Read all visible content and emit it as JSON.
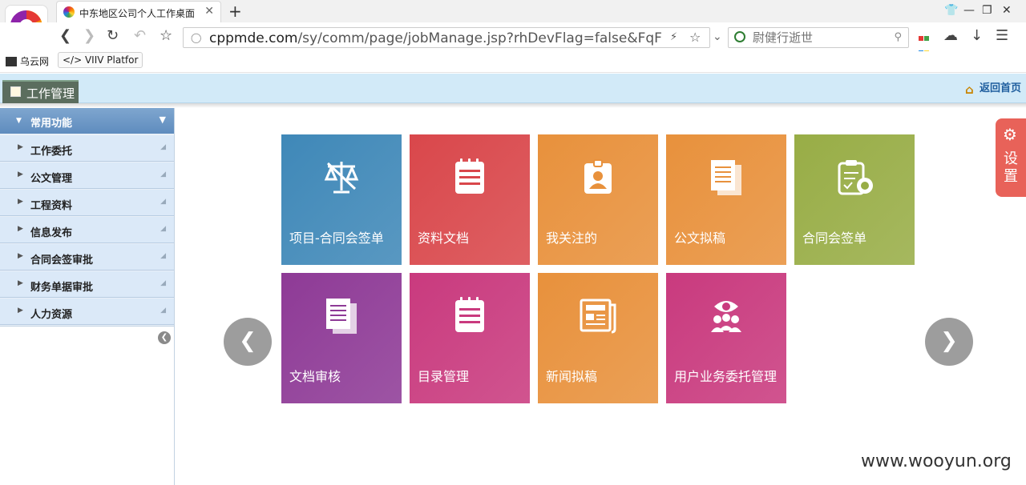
{
  "browser": {
    "tab_title": "中东地区公司个人工作桌面",
    "url_domain": "cppmde.com",
    "url_path": "/sy/comm/page/jobManage.jsp?rhDevFlag=false&FqFlag=GZT_W",
    "search_placeholder": "尉健行逝世",
    "bookmarks": [
      {
        "label": "乌云网"
      },
      {
        "label": "</> VIIV Platfor"
      }
    ]
  },
  "app": {
    "header_tab": "工作管理",
    "home_link": "返回首页"
  },
  "sidebar": {
    "header": "常用功能",
    "items": [
      {
        "label": "工作委托"
      },
      {
        "label": "公文管理"
      },
      {
        "label": "工程资料"
      },
      {
        "label": "信息发布"
      },
      {
        "label": "合同会签审批"
      },
      {
        "label": "财务单据审批"
      },
      {
        "label": "人力资源"
      }
    ]
  },
  "tiles": [
    {
      "label": "项目-合同会签单",
      "color": "#3f88b8",
      "icon": "scales-icon"
    },
    {
      "label": "资料文档",
      "color": "#d9474b",
      "icon": "notepad-icon"
    },
    {
      "label": "我关注的",
      "color": "#e8913c",
      "icon": "badge-icon"
    },
    {
      "label": "公文拟稿",
      "color": "#e8913c",
      "icon": "documents-icon"
    },
    {
      "label": "合同会签单",
      "color": "#98ad46",
      "icon": "clipboard-icon"
    },
    {
      "label": "文档审核",
      "color": "#8e3a96",
      "icon": "documents-icon"
    },
    {
      "label": "目录管理",
      "color": "#c93a7e",
      "icon": "notepad-icon"
    },
    {
      "label": "新闻拟稿",
      "color": "#e8913c",
      "icon": "newspaper-icon"
    },
    {
      "label": "用户业务委托管理",
      "color": "#c93a7e",
      "icon": "users-icon"
    }
  ],
  "settings_label": "设置",
  "watermark": "www.wooyun.org"
}
